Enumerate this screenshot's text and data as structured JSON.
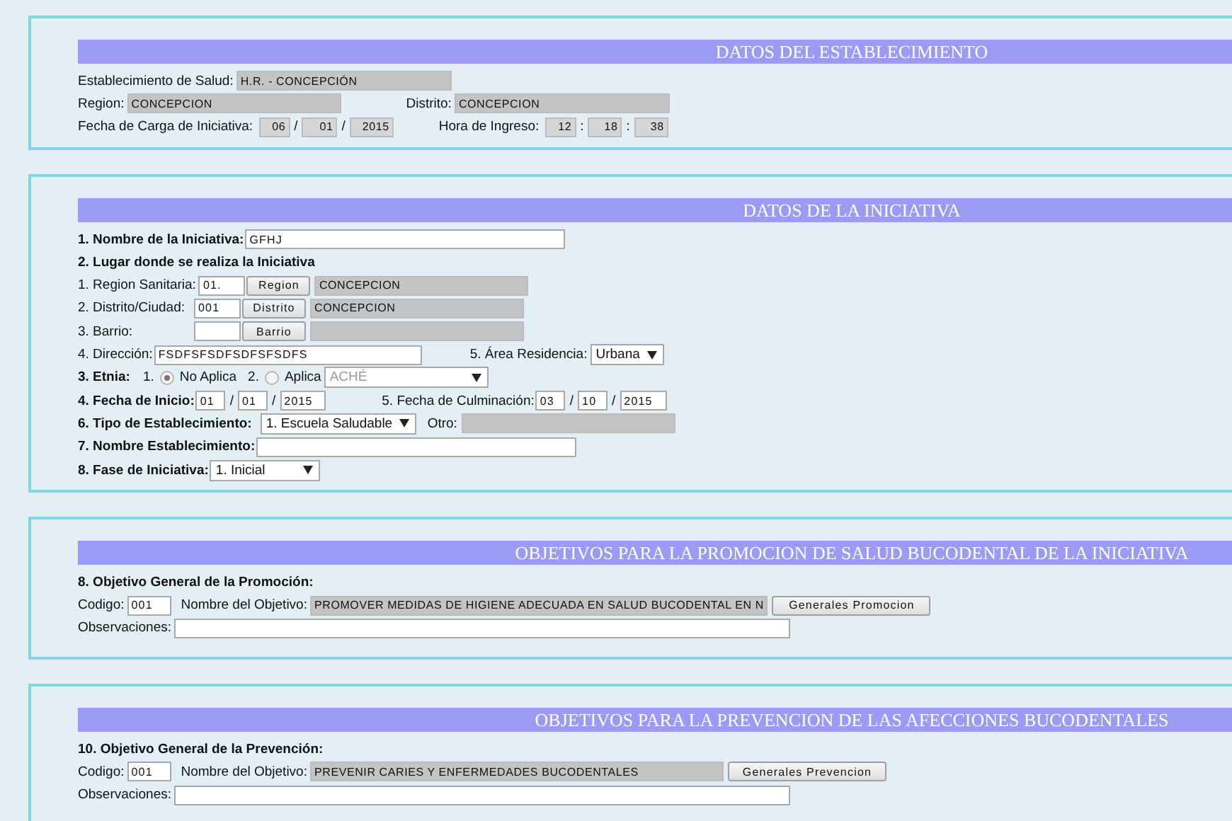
{
  "establecimiento": {
    "title": "DATOS DEL ESTABLECIMIENTO",
    "salud": {
      "label": "Establecimiento de Salud:",
      "value": "H.R. - CONCEPCIÓN",
      "readonly": true
    },
    "region": {
      "label": "Region:",
      "value": "CONCEPCION",
      "readonly": true
    },
    "distrito": {
      "label": "Distrito:",
      "value": "CONCEPCION",
      "readonly": true
    },
    "fecha_carga": {
      "label": "Fecha de Carga de Iniciativa:",
      "parts": [
        "06",
        "01",
        "2015"
      ],
      "separators": [
        "/",
        "/"
      ],
      "readonly": true
    },
    "hora": {
      "label": "Hora de Ingreso:",
      "parts": [
        "12",
        "18",
        "38"
      ],
      "separators": [
        ":",
        ":"
      ],
      "readonly": true
    }
  },
  "iniciativa": {
    "title": "DATOS DE LA INICIATIVA",
    "nombre": {
      "label": "1. Nombre de la Iniciativa:",
      "value": "GFHJ",
      "readonly": false
    },
    "lugar_heading": "2. Lugar donde se realiza la Iniciativa",
    "lugar": [
      {
        "label": "1. Region Sanitaria:",
        "code": "01.",
        "button": "Region",
        "value": "CONCEPCION"
      },
      {
        "label": "2. Distrito/Ciudad:",
        "code": "001",
        "button": "Distrito",
        "value": "CONCEPCION"
      },
      {
        "label": "3. Barrio:",
        "button": "Barrio"
      }
    ],
    "direccion": {
      "label": "4. Dirección:",
      "value": "FSDFSFSDFSDFSFSDFS",
      "readonly": false
    },
    "area": {
      "label": "5. Área Residencia:",
      "value": "Urbana",
      "disabled": false
    },
    "etnia": {
      "label": "3. Etnia:",
      "options": [
        {
          "number": "1.",
          "label": "No Aplica",
          "selected": true
        },
        {
          "number": "2.",
          "label": "Aplica",
          "selected": false
        }
      ],
      "select": {
        "value": "ACHÉ",
        "disabled": true
      }
    },
    "fecha_inicio": {
      "label": "4. Fecha de Inicio:",
      "parts": [
        "01",
        "01",
        "2015"
      ],
      "separators": [
        "/",
        "/"
      ],
      "readonly": false
    },
    "fecha_culminacion": {
      "label": "5. Fecha de Culminación:",
      "parts": [
        "03",
        "10",
        "2015"
      ],
      "separators": [
        "/",
        "/"
      ],
      "readonly": false
    },
    "tipo": {
      "label": "6. Tipo de Establecimiento:",
      "value": "1. Escuela Saludable",
      "disabled": false
    },
    "otro": {
      "label": "Otro:",
      "readonly": true
    },
    "nombre_establecimiento": {
      "label": "7. Nombre Establecimiento:",
      "readonly": false
    },
    "fase": {
      "label": "8. Fase de Iniciativa:",
      "value": "1. Inicial",
      "disabled": false
    }
  },
  "objetivos": [
    {
      "title": "OBJETIVOS PARA LA PROMOCION DE SALUD BUCODENTAL DE LA INICIATIVA",
      "heading": "8. Objetivo General de la Promoción:",
      "codigo_label": "Codigo:",
      "codigo": "001",
      "nombre_label": "Nombre del Objetivo:",
      "nombre": "PROMOVER MEDIDAS DE HIGIENE ADECUADA EN SALUD BUCODENTAL EN N",
      "button": "Generales Promocion",
      "observaciones_label": "Observaciones:"
    },
    {
      "title": "OBJETIVOS PARA LA PREVENCION DE LAS AFECCIONES BUCODENTALES",
      "heading": "10. Objetivo General de la Prevención:",
      "codigo_label": "Codigo:",
      "codigo": "001",
      "nombre_label": "Nombre del Objetivo:",
      "nombre": "PREVENIR CARIES Y ENFERMEDADES BUCODENTALES",
      "button": "Generales Prevencion",
      "observaciones_label": "Observaciones:"
    }
  ]
}
